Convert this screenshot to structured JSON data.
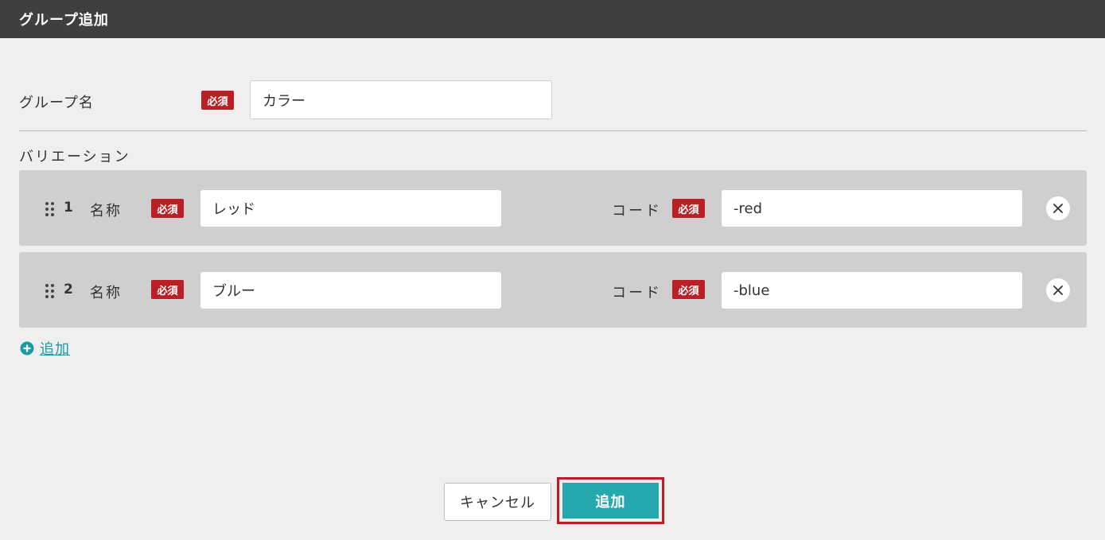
{
  "header": {
    "title": "グループ追加"
  },
  "group": {
    "label": "グループ名",
    "required_badge": "必須",
    "value": "カラー"
  },
  "variations": {
    "heading": "バリエーション",
    "items": [
      {
        "number": "1",
        "name_label": "名称",
        "name_required": "必須",
        "name_value": "レッド",
        "code_label": "コード",
        "code_required": "必須",
        "code_value": "-red"
      },
      {
        "number": "2",
        "name_label": "名称",
        "name_required": "必須",
        "name_value": "ブルー",
        "code_label": "コード",
        "code_required": "必須",
        "code_value": "-blue"
      }
    ],
    "add_label": "追加"
  },
  "footer": {
    "cancel_label": "キャンセル",
    "submit_label": "追加"
  },
  "colors": {
    "header_bg": "#3f3f3f",
    "required_badge": "#b91f25",
    "accent": "#26a9ae",
    "link": "#1a9aa3",
    "highlight_border": "#b81e28"
  },
  "icons": {
    "drag": "drag-handle-icon",
    "remove": "close-icon",
    "add": "plus-circle-icon"
  }
}
